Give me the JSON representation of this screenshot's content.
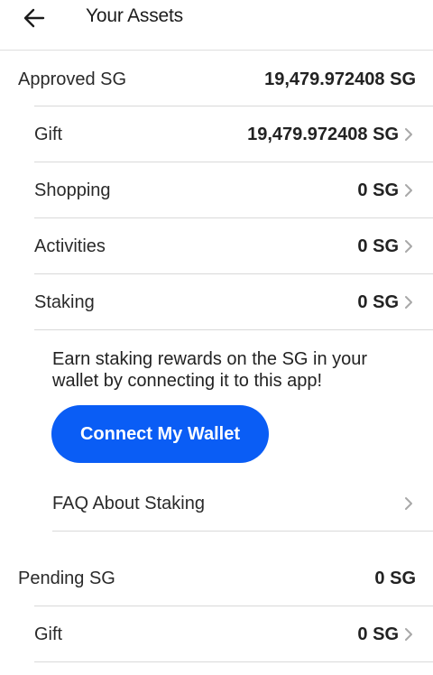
{
  "header": {
    "title": "Your Assets",
    "back_icon": "arrow-left-icon"
  },
  "approved": {
    "label": "Approved SG",
    "value": "19,479.972408 SG",
    "items": [
      {
        "label": "Gift",
        "value": "19,479.972408 SG"
      },
      {
        "label": "Shopping",
        "value": "0 SG"
      },
      {
        "label": "Activities",
        "value": "0 SG"
      },
      {
        "label": "Staking",
        "value": "0 SG"
      }
    ]
  },
  "staking_promo": {
    "text": "Earn staking rewards on the SG in your wallet by connecting it to this app!",
    "button_label": "Connect My Wallet",
    "faq_label": "FAQ About Staking"
  },
  "pending": {
    "label": "Pending SG",
    "value": "0 SG",
    "items": [
      {
        "label": "Gift",
        "value": "0 SG"
      }
    ]
  },
  "colors": {
    "accent": "#0a5df5",
    "divider": "#d9d9d9",
    "chevron": "#a8a8a8"
  }
}
